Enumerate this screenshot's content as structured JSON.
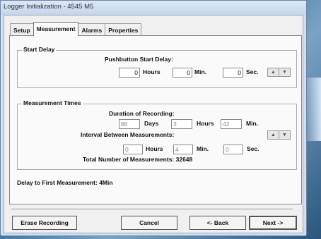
{
  "window": {
    "title": "Logger Initialization - 4545 M5"
  },
  "tabs": [
    {
      "label": "Setup",
      "active": false
    },
    {
      "label": "Measurement",
      "active": true
    },
    {
      "label": "Alarms",
      "active": false
    },
    {
      "label": "Properties",
      "active": false
    }
  ],
  "start_delay": {
    "group_title": "Start Delay",
    "heading": "Pushbutton Start Delay:",
    "hours_value": "0",
    "hours_label": "Hours",
    "min_value": "0",
    "min_label": "Min.",
    "sec_value": "0",
    "sec_label": "Sec."
  },
  "measurement_times": {
    "group_title": "Measurement Times",
    "duration_heading": "Duration of Recording:",
    "duration_days": "86",
    "days_label": "Days",
    "duration_hours": "3",
    "hours_label": "Hours",
    "duration_min": "42",
    "min_label": "Min.",
    "interval_heading": "Interval Between Measurements:",
    "interval_hours": "0",
    "interval_hours_label": "Hours",
    "interval_min": "4",
    "interval_min_label": "Min.",
    "interval_sec": "0",
    "interval_sec_label": "Sec.",
    "total_text": "Total Number of Measurements:  32648"
  },
  "delay_text": "Delay to First Measurement: 4Min",
  "buttons": {
    "erase": "Erase Recording",
    "cancel": "Cancel",
    "back": "<- Back",
    "next": "Next ->"
  },
  "spinner": {
    "up": "▲",
    "down": "▼"
  }
}
